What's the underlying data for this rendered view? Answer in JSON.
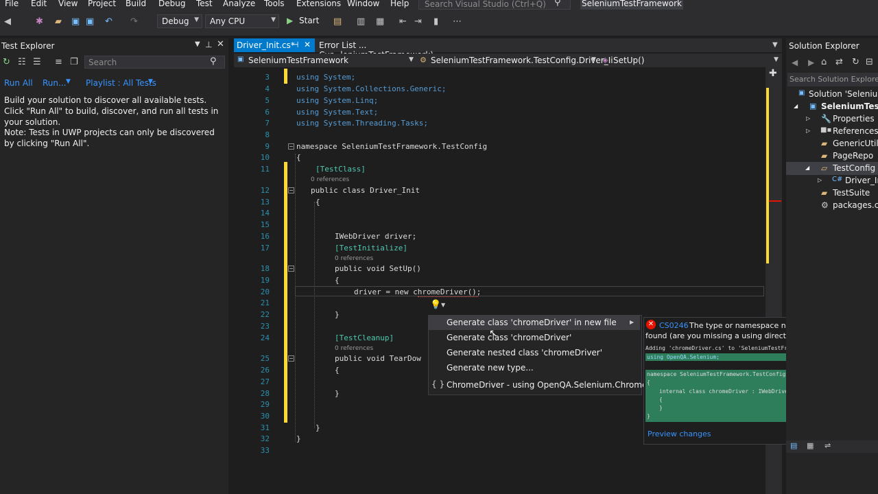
{
  "menu": [
    "File",
    "Edit",
    "View",
    "Project",
    "Build",
    "Debug",
    "Test",
    "Analyze",
    "Tools",
    "Extensions",
    "Window",
    "Help"
  ],
  "search_placeholder": "Search Visual Studio (Ctrl+Q)",
  "window_title": "SeleniumTestFramework",
  "toolbar": {
    "config": "Debug",
    "platform": "Any CPU",
    "start": "Start"
  },
  "test_explorer": {
    "title": "Test Explorer",
    "search": "Search",
    "run_all": "Run All",
    "run": "Run...",
    "playlist": "Playlist : All Tests",
    "message1": "Build your solution to discover all available tests. Click \"Run All\" to build, discover, and run all tests in your solution.",
    "message2": "Note: Tests in UWP projects can only be discovered by clicking \"Run All\"."
  },
  "tabs": {
    "active": "Driver_Init.cs*",
    "other": "Error List ... Cur...leniumTestFramework)"
  },
  "navbar": {
    "project": "SeleniumTestFramework",
    "class": "SeleniumTestFramework.TestConfig.Driver_Ii",
    "member": "SetUp()"
  },
  "code": {
    "l3": "using System;",
    "l4": "using System.Collections.Generic;",
    "l5": "using System.Linq;",
    "l6": "using System.Text;",
    "l7": "using System.Threading.Tasks;",
    "l9": "namespace SeleniumTestFramework.TestConfig",
    "l11": "[TestClass]",
    "refs0": "0 references",
    "l12": "public class Driver_Init",
    "l16": "IWebDriver driver;",
    "l17": "[TestInitialize]",
    "l18": "public void SetUp()",
    "l20": "driver = new chromeDriver();",
    "l24": "[TestCleanup]",
    "l25": "public void TearDow"
  },
  "line_numbers": [
    "3",
    "4",
    "5",
    "6",
    "7",
    "8",
    "9",
    "10",
    "11",
    "12",
    "13",
    "14",
    "15",
    "16",
    "17",
    "18",
    "19",
    "20",
    "21",
    "22",
    "23",
    "24",
    "25",
    "26",
    "27",
    "28",
    "29",
    "30",
    "31",
    "32",
    "33"
  ],
  "quick_actions": [
    "Generate class 'chromeDriver' in new file",
    "Generate class 'chromeDriver'",
    "Generate nested class 'chromeDriver'",
    "Generate new type...",
    "ChromeDriver - using OpenQA.Selenium.Chrome;"
  ],
  "preview": {
    "code": "CS0246",
    "message": "The type or namespace name 'chromeDriver' could n",
    "message2": "found (are you missing a using directive or an assembly reference",
    "adding": "Adding 'chromeDriver.cs' to 'SeleniumTestFramework' with content",
    "using": "using OpenQA.Selenium;",
    "ns": "namespace SeleniumTestFramework.TestConfig",
    "brace_open": "{",
    "cls": "internal class chromeDriver : IWebDriver",
    "inner_open": "{",
    "inner_close": "}",
    "brace_close": "}",
    "link": "Preview changes"
  },
  "solution_explorer": {
    "title": "Solution Explorer",
    "search": "Search Solution Explorer",
    "items": [
      "Solution 'SeleniumT",
      "SeleniumTestFr",
      "Properties",
      "References",
      "GenericUtils",
      "PageRepo",
      "TestConfig",
      "Driver_Ini",
      "TestSuite",
      "packages.co"
    ]
  }
}
